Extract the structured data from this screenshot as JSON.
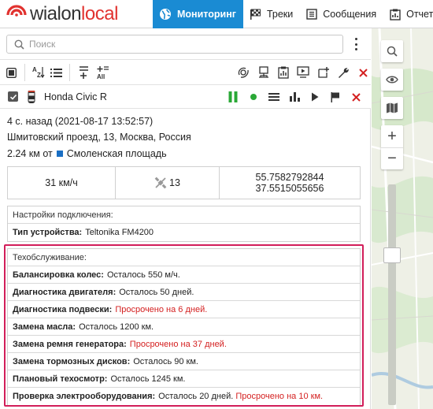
{
  "app": {
    "brand_main": "wialon",
    "brand_accent": "local"
  },
  "nav": [
    {
      "label": "Мониторинг",
      "icon": "globe-icon",
      "active": true
    },
    {
      "label": "Треки",
      "icon": "checkered-flag-icon",
      "active": false
    },
    {
      "label": "Сообщения",
      "icon": "messages-icon",
      "active": false
    },
    {
      "label": "Отчеты",
      "icon": "reports-icon",
      "active": false
    }
  ],
  "search": {
    "placeholder": "Поиск",
    "value": ""
  },
  "unit": {
    "name": "Honda Civic R",
    "checked": true
  },
  "info": {
    "last_message": "4 с. назад (2021-08-17 13:52:57)",
    "address": "Шмитовский проезд, 13, Москва, Россия",
    "distance_value": "2.24 км от",
    "distance_place": "Смоленская площадь",
    "speed": "31 км/ч",
    "satellites": "13",
    "lat": "55.7582792844",
    "lon": "37.5515055656"
  },
  "connection": {
    "title": "Настройки подключения:",
    "device_label": "Тип устройства:",
    "device_value": "Teltonika FM4200"
  },
  "maintenance": {
    "title": "Техобслуживание:",
    "items": [
      {
        "label": "Балансировка колес:",
        "status": "Осталось 550 м/ч.",
        "overdue": ""
      },
      {
        "label": "Диагностика двигателя:",
        "status": "Осталось 50 дней.",
        "overdue": ""
      },
      {
        "label": "Диагностика подвески:",
        "status": "",
        "overdue": "Просрочено на 6 дней."
      },
      {
        "label": "Замена масла:",
        "status": "Осталось 1200 км.",
        "overdue": ""
      },
      {
        "label": "Замена ремня генератора:",
        "status": "",
        "overdue": "Просрочено на 37 дней."
      },
      {
        "label": "Замена тормозных дисков:",
        "status": "Осталось 90 км.",
        "overdue": ""
      },
      {
        "label": "Плановый техосмотр:",
        "status": "Осталось 1245 км.",
        "overdue": ""
      },
      {
        "label": "Проверка электрооборудования:",
        "status": "Осталось 20 дней.",
        "overdue": "Просрочено на 10 км."
      }
    ]
  },
  "map": {
    "zoom_in": "+",
    "zoom_out": "−"
  },
  "colors": {
    "accent": "#1a8bd3",
    "brand_red": "#e1322f",
    "overdue": "#d42121",
    "highlight": "#d21e5a",
    "unit_ok": "#2aa836"
  }
}
